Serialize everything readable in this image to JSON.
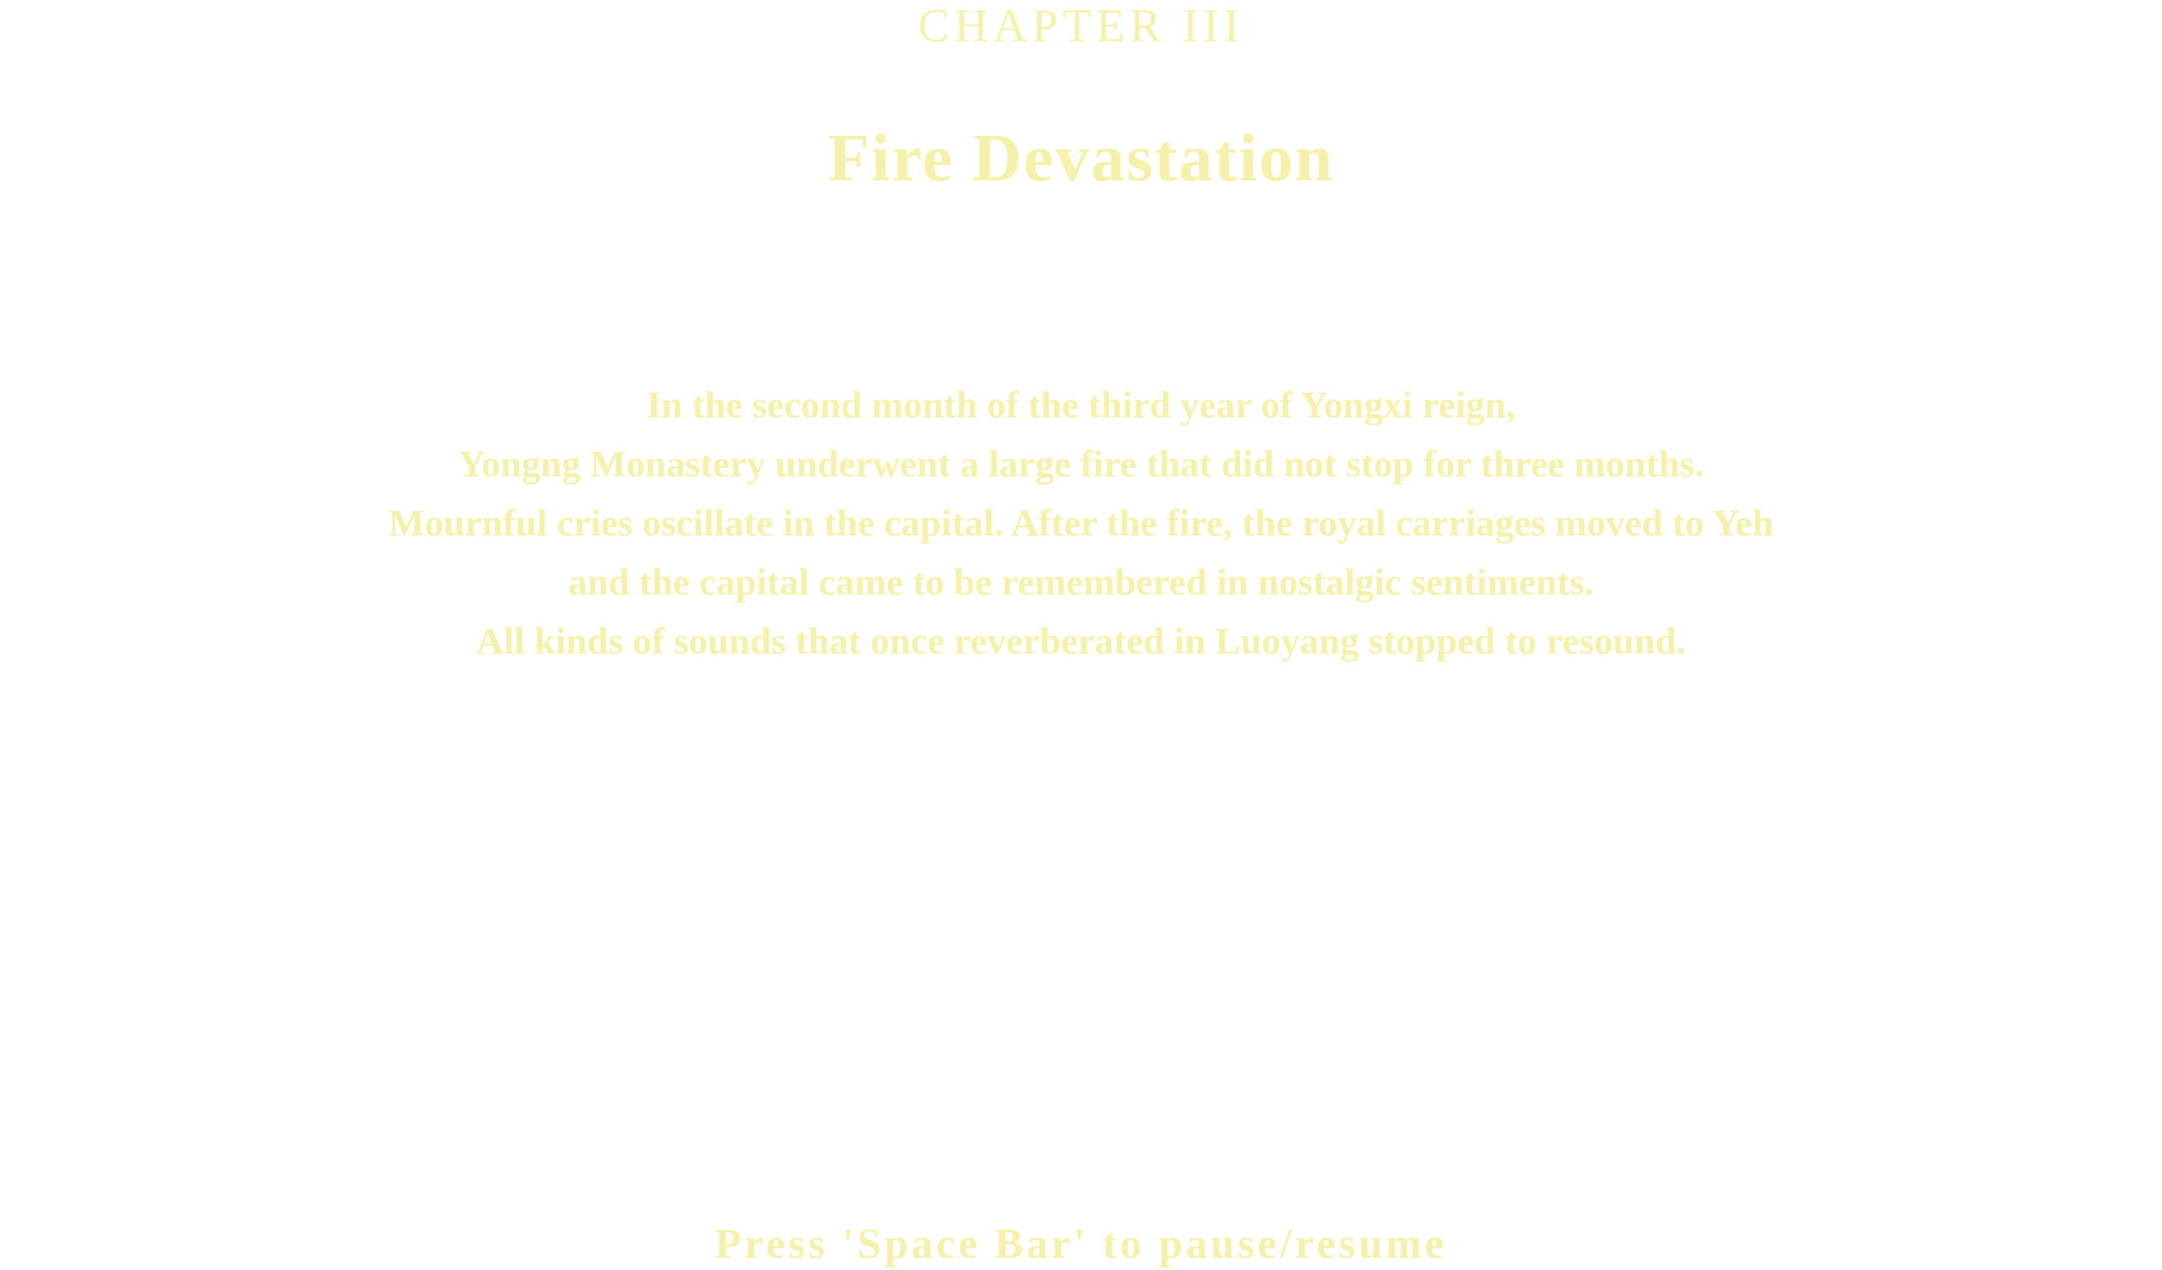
{
  "chapter": {
    "label": "CHAPTER III",
    "title": "Fire Devastation"
  },
  "body": {
    "lines": [
      "In the second month of the third year of Yongxi reign,",
      "Yongng Monastery underwent a large fire that did not stop for three months.",
      "Mournful cries oscillate in the capital. After the fire, the royal carriages moved to Yeh",
      "and the capital came to be remembered in nostalgic sentiments.",
      "All kinds of sounds that once reverberated in Luoyang stopped to resound."
    ]
  },
  "hint": {
    "text": "Press 'Space Bar' to pause/resume"
  },
  "colors": {
    "text": "#f6f1a8",
    "background": "#ffffff"
  }
}
